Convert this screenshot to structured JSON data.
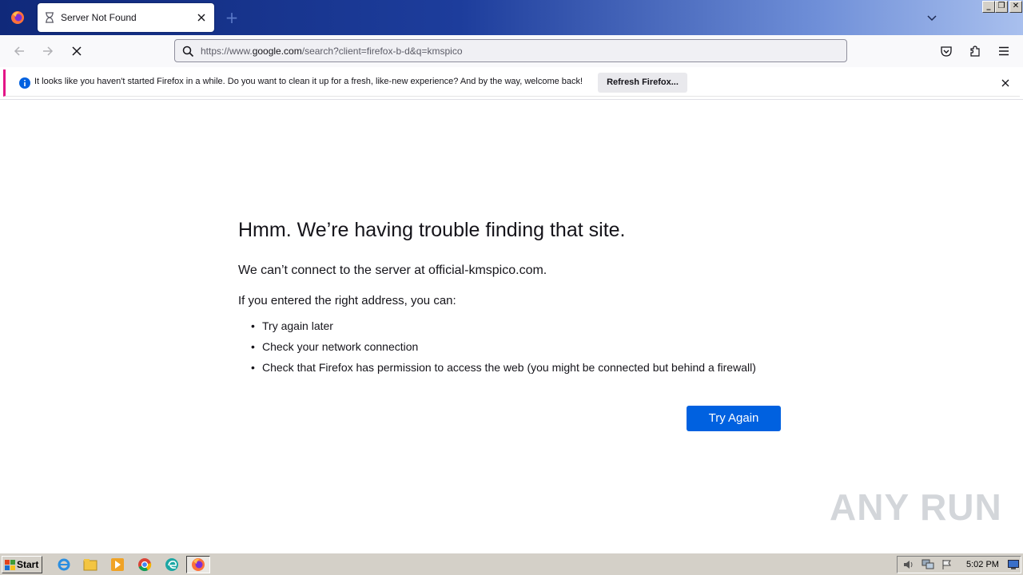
{
  "browser": {
    "tab": {
      "title": "Server Not Found"
    },
    "url": {
      "prefix": "https://www.",
      "domain": "google.com",
      "path": "/search?client=firefox-b-d&q=kmspico"
    },
    "notification": {
      "text": "It looks like you haven't started Firefox in a while. Do you want to clean it up for a fresh, like-new experience? And by the way, welcome back!",
      "button_label": "Refresh Firefox..."
    }
  },
  "error_page": {
    "title": "Hmm. We’re having trouble finding that site.",
    "description": "We can’t connect to the server at official-kmspico.com.",
    "heading": "If you entered the right address, you can:",
    "suggestions": [
      "Try again later",
      "Check your network connection",
      "Check that Firefox has permission to access the web (you might be connected but behind a firewall)"
    ],
    "try_again_label": "Try Again"
  },
  "watermark": "ANY RUN",
  "taskbar": {
    "start_label": "Start",
    "clock": "5:02 PM",
    "icons": [
      "ie-icon",
      "explorer-icon",
      "media-player-icon",
      "chrome-icon",
      "edge-icon",
      "firefox-icon"
    ]
  },
  "colors": {
    "accent": "#0061e0",
    "notification_bar": "#e31587",
    "tab_strip": "#1d3d9c"
  }
}
